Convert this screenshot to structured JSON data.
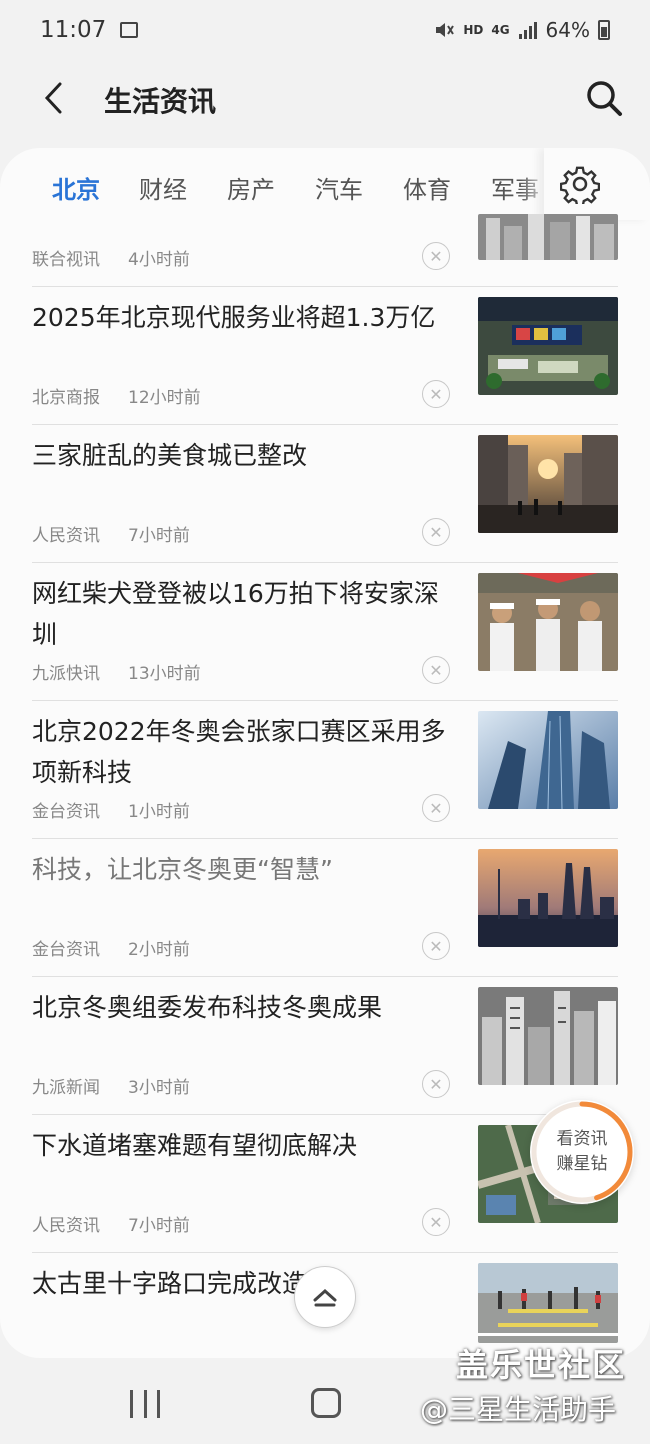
{
  "status_bar": {
    "time": "11:07",
    "signal_label": "HD",
    "network_label": "4G",
    "battery": "64%"
  },
  "header": {
    "title": "生活资讯"
  },
  "tabs": [
    "北京",
    "财经",
    "房产",
    "汽车",
    "体育",
    "军事"
  ],
  "active_tab": "北京",
  "news": [
    {
      "title": "",
      "source": "联合视讯",
      "time": "4小时前",
      "thumb": "city-gray"
    },
    {
      "title": "2025年北京现代服务业将超1.3万亿",
      "source": "北京商报",
      "time": "12小时前",
      "thumb": "expo-hall"
    },
    {
      "title": "三家脏乱的美食城已整改",
      "source": "人民资讯",
      "time": "7小时前",
      "thumb": "street-sunset"
    },
    {
      "title": "网红柴犬登登被以16万拍下将安家深圳",
      "source": "九派快讯",
      "time": "13小时前",
      "thumb": "parade"
    },
    {
      "title": "北京2022年冬奥会张家口赛区采用多项新科技",
      "source": "金台资讯",
      "time": "1小时前",
      "thumb": "skyscraper"
    },
    {
      "title": "科技，让北京冬奥更“智慧”",
      "source": "金台资讯",
      "time": "2小时前",
      "thumb": "skyline-dusk"
    },
    {
      "title": "北京冬奥组委发布科技冬奥成果",
      "source": "九派新闻",
      "time": "3小时前",
      "thumb": "city-gray"
    },
    {
      "title": "下水道堵塞难题有望彻底解决",
      "source": "人民资讯",
      "time": "7小时前",
      "thumb": "aerial"
    },
    {
      "title": "太古里十字路口完成改造",
      "source": "",
      "time": "",
      "thumb": "crosswalk"
    }
  ],
  "reward_badge": {
    "line1": "看资讯",
    "line2": "赚星钻",
    "progress": 0.45
  },
  "watermark": {
    "line1": "盖乐世社区",
    "line2": "@三星生活助手"
  },
  "colors": {
    "accent": "#2a74d6",
    "progress": "#f28a3a"
  }
}
